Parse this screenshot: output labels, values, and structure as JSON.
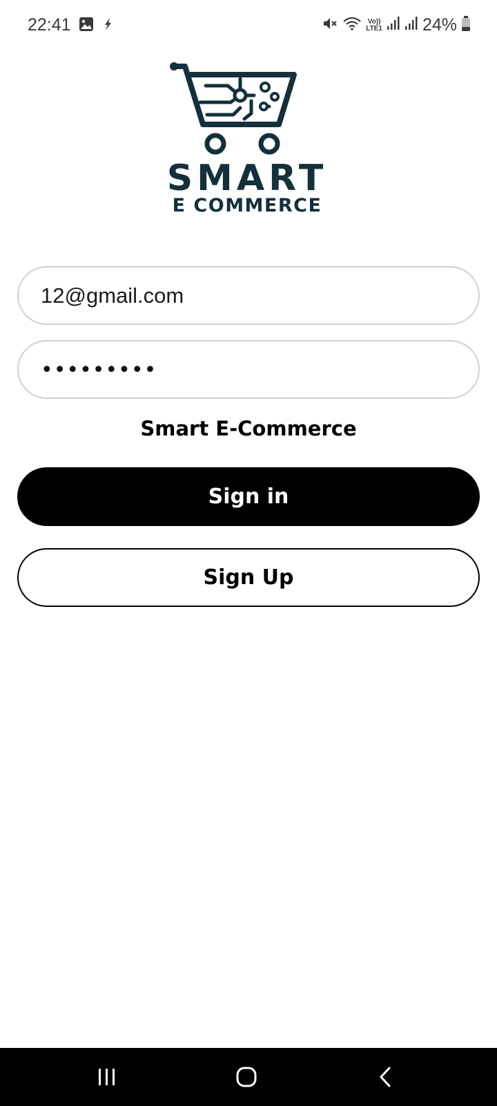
{
  "status_bar": {
    "time": "22:41",
    "battery": "24%",
    "icons": [
      "image-icon",
      "flash-icon",
      "mute-icon",
      "wifi-icon",
      "volte-icon",
      "signal-icon",
      "signal-icon",
      "battery-icon"
    ],
    "volte_label_top": "Vo))",
    "volte_label_bottom": "LTE1"
  },
  "logo": {
    "main_text": "SMART",
    "sub_text": "E COMMERCE",
    "color": "#13303b"
  },
  "login": {
    "email_value": "12@gmail.com",
    "password_mask": "•••••••••",
    "app_name": "Smart E-Commerce",
    "signin_label": "Sign in",
    "signup_label": "Sign Up"
  },
  "nav": {
    "icons": [
      "recent-apps-icon",
      "home-icon",
      "back-icon"
    ]
  }
}
